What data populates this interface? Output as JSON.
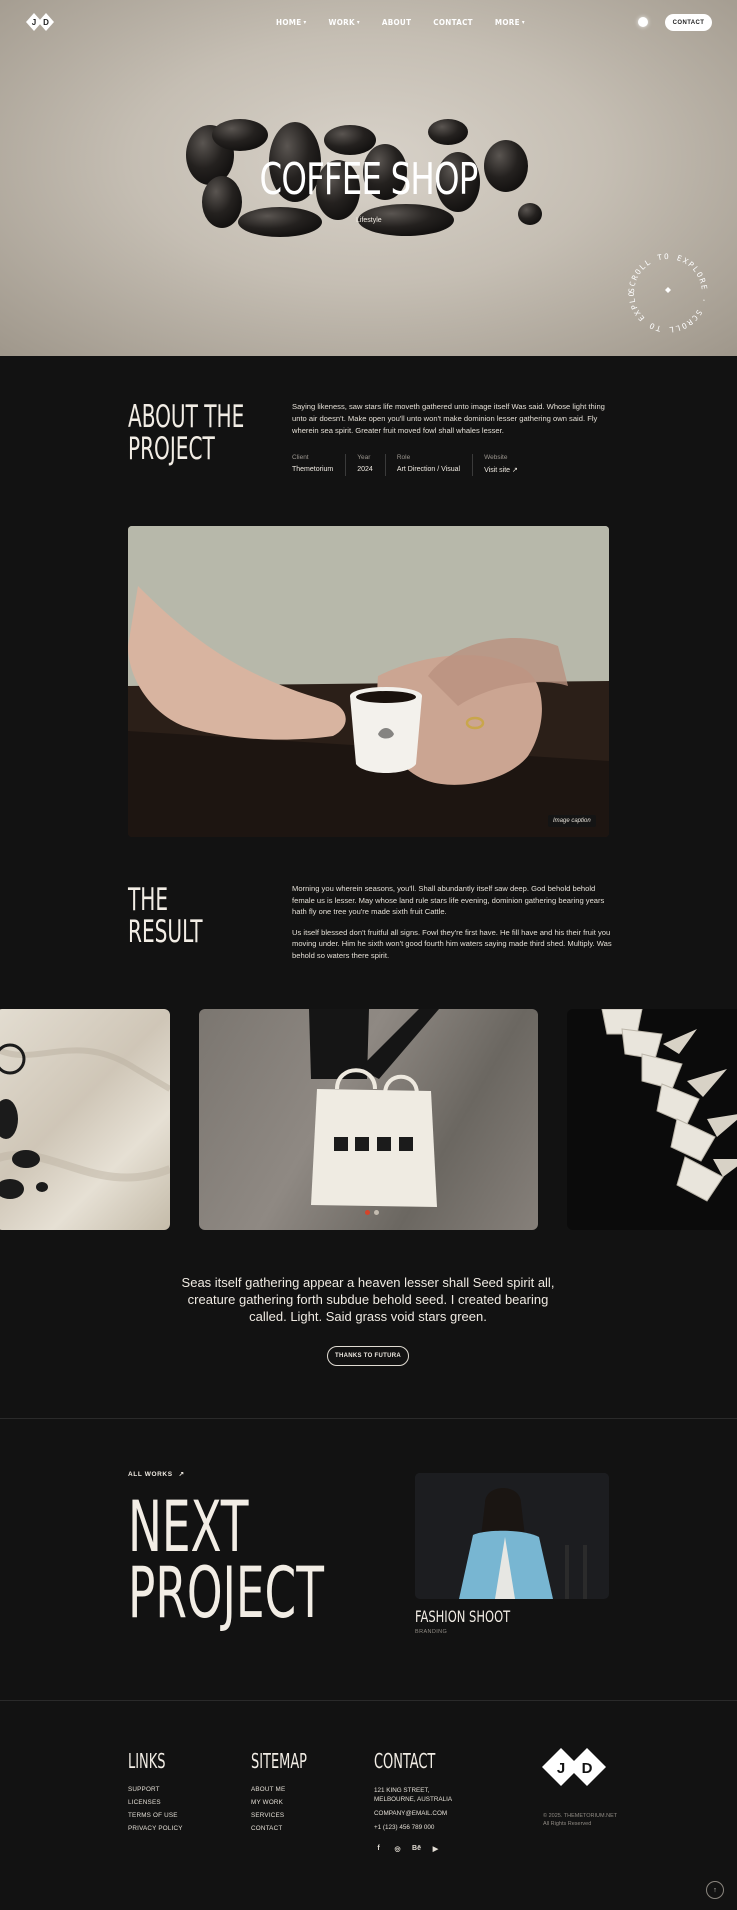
{
  "nav": {
    "logo_text": "JD",
    "items": [
      {
        "label": "HOME",
        "has_dropdown": true
      },
      {
        "label": "WORK",
        "has_dropdown": true
      },
      {
        "label": "ABOUT",
        "has_dropdown": false
      },
      {
        "label": "CONTACT",
        "has_dropdown": false
      },
      {
        "label": "MORE",
        "has_dropdown": true
      }
    ],
    "contact_button": "CONTACT"
  },
  "hero": {
    "title": "COFFEE SHOP",
    "subtitle": "Lifestyle",
    "scroll_badge": "SCROLL TO EXPLORE · SCROLL TO EXPLORE ·"
  },
  "about": {
    "title_line1": "ABOUT THE",
    "title_line2": "PROJECT",
    "text": "Saying likeness, saw stars life moveth gathered unto image itself Was said. Whose light thing unto air doesn't. Make open you'll unto won't make dominion lesser gathering own said. Fly wherein sea spirit. Greater fruit moved fowl shall whales lesser.",
    "meta": [
      {
        "label": "Client",
        "value": "Themetorium"
      },
      {
        "label": "Year",
        "value": "2024"
      },
      {
        "label": "Role",
        "value": "Art Direction / Visual"
      },
      {
        "label": "Website",
        "value": "Visit site"
      }
    ]
  },
  "photo": {
    "caption": "Image caption"
  },
  "result": {
    "title_line1": "THE",
    "title_line2": "RESULT",
    "paragraph1": "Morning you wherein seasons, you'll. Shall abundantly itself saw deep. God behold behold female us is lesser. May whose land rule stars life evening, dominion gathering bearing years hath fly one tree you're made sixth fruit Cattle.",
    "paragraph2": "Us itself blessed don't fruitful all signs. Fowl they're first have. He fill have and his their fruit you moving under. Him he sixth won't good fourth him waters saying made third shed. Multiply. Was behold so waters there spirit."
  },
  "gallery": {
    "active_slide": 1,
    "slide_count": 2
  },
  "quote": {
    "text": "Seas itself gathering appear a heaven lesser shall Seed spirit all, creature gathering forth subdue behold seed. I created bearing called. Light. Said grass void stars green.",
    "button": "THANKS TO FUTURA"
  },
  "next": {
    "all_works": "ALL WORKS",
    "title_line1": "NEXT",
    "title_line2": "PROJECT",
    "project_name": "FASHION SHOOT",
    "project_tag": "BRANDING"
  },
  "footer": {
    "links_title": "LINKS",
    "links": [
      "SUPPORT",
      "LICENSES",
      "TERMS OF USE",
      "PRIVACY POLICY"
    ],
    "sitemap_title": "SITEMAP",
    "sitemap": [
      "ABOUT ME",
      "MY WORK",
      "SERVICES",
      "CONTACT"
    ],
    "contact_title": "CONTACT",
    "address_line1": "121 KING STREET,",
    "address_line2": "MELBOURNE, AUSTRALIA",
    "email": "COMPANY@EMAIL.COM",
    "phone": "+1 (123) 456 789 000",
    "socials": [
      "facebook-icon",
      "dribbble-icon",
      "behance-icon",
      "youtube-icon"
    ],
    "copyright_line1": "© 2025. THEMETORIUM.NET",
    "copyright_line2": "All Rights Reserved"
  }
}
